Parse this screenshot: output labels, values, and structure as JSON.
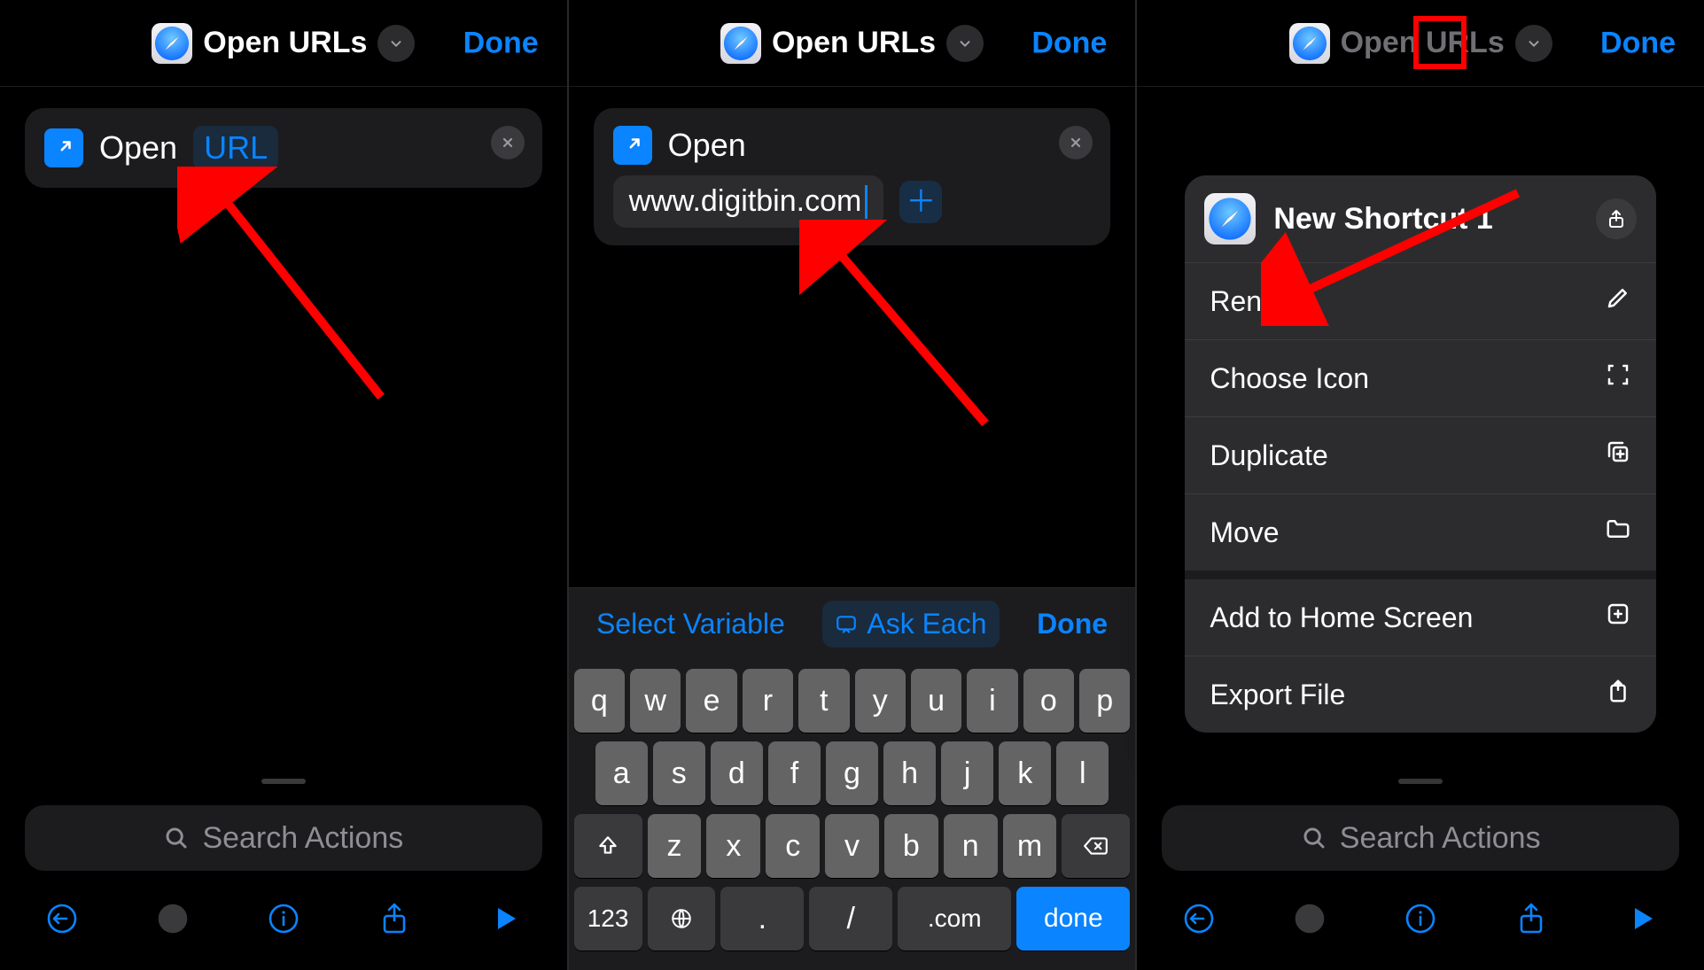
{
  "header": {
    "title": "Open URLs",
    "done": "Done"
  },
  "action": {
    "open_label": "Open",
    "url_token": "URL",
    "url_value": "www.digitbin.com"
  },
  "search": {
    "placeholder": "Search Actions"
  },
  "keyboard": {
    "select_variable": "Select Variable",
    "ask_each": "Ask Each",
    "done": "Done",
    "row1": [
      "q",
      "w",
      "e",
      "r",
      "t",
      "y",
      "u",
      "i",
      "o",
      "p"
    ],
    "row2": [
      "a",
      "s",
      "d",
      "f",
      "g",
      "h",
      "j",
      "k",
      "l"
    ],
    "row3": [
      "z",
      "x",
      "c",
      "v",
      "b",
      "n",
      "m"
    ],
    "fn_123": "123",
    "dot": ".",
    "slash": "/",
    "dotcom": ".com",
    "done_key": "done"
  },
  "popover": {
    "shortcut_name": "New Shortcut 1",
    "items_a": [
      {
        "label": "Rename",
        "icon": "pencil"
      },
      {
        "label": "Choose Icon",
        "icon": "bracket-square"
      },
      {
        "label": "Duplicate",
        "icon": "copy-plus"
      },
      {
        "label": "Move",
        "icon": "folder"
      }
    ],
    "items_b": [
      {
        "label": "Add to Home Screen",
        "icon": "plus-square"
      },
      {
        "label": "Export File",
        "icon": "doc-share"
      }
    ]
  }
}
